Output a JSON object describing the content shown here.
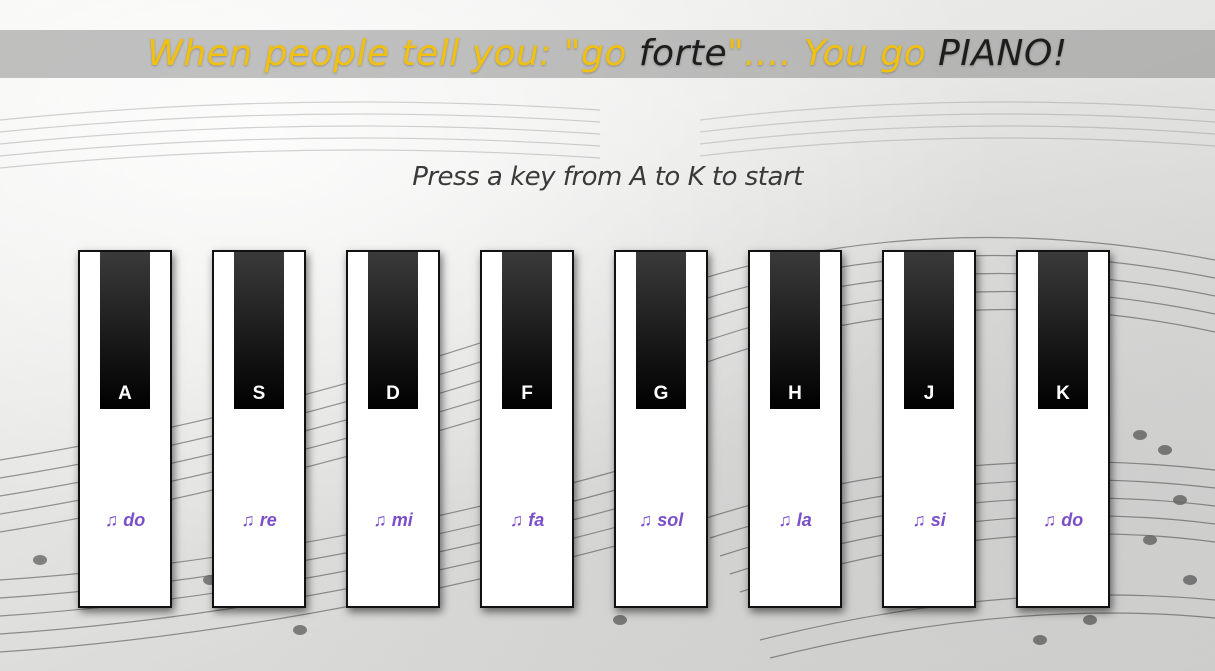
{
  "banner": {
    "part1": "When people tell you: \"go ",
    "part2": "forte",
    "part3": "\".... You go ",
    "part4": "PIANO!"
  },
  "subtitle": "Press a key from A to K to start",
  "keys": [
    {
      "letter": "A",
      "note_symbol": "♫",
      "note": "do"
    },
    {
      "letter": "S",
      "note_symbol": "♫",
      "note": "re"
    },
    {
      "letter": "D",
      "note_symbol": "♫",
      "note": "mi"
    },
    {
      "letter": "F",
      "note_symbol": "♫",
      "note": "fa"
    },
    {
      "letter": "G",
      "note_symbol": "♫",
      "note": "sol"
    },
    {
      "letter": "H",
      "note_symbol": "♫",
      "note": "la"
    },
    {
      "letter": "J",
      "note_symbol": "♫",
      "note": "si"
    },
    {
      "letter": "K",
      "note_symbol": "♫",
      "note": "do"
    }
  ],
  "colors": {
    "banner_gold": "#f2c10f",
    "banner_dark": "#1d1d1d",
    "note_purple": "#7b4fc9",
    "key_white": "#ffffff",
    "key_black": "#000000"
  },
  "icons": {
    "note_icon": "music-note-icon"
  }
}
